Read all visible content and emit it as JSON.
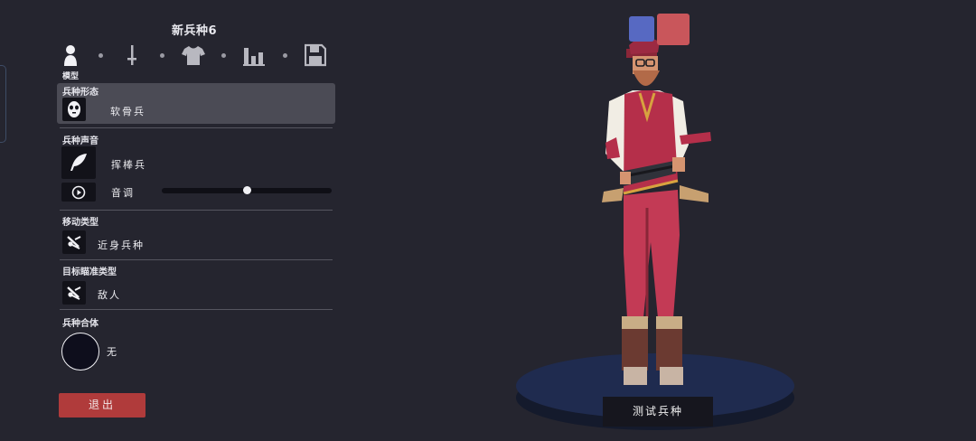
{
  "header": {
    "title": "新兵种6"
  },
  "tabs": {
    "active_label": "模型"
  },
  "sections": {
    "form": {
      "label": "兵种形态",
      "value": "软骨兵"
    },
    "voice": {
      "label": "兵种声音",
      "value": "挥棒兵",
      "pitch_label": "音调",
      "pitch_level": 0.5
    },
    "movement": {
      "label": "移动类型",
      "value": "近身兵种"
    },
    "targeting": {
      "label": "目标瞄准类型",
      "value": "敌人"
    },
    "merge": {
      "label": "兵种合体",
      "value": "无"
    }
  },
  "buttons": {
    "exit": "退出",
    "test": "测试兵种"
  },
  "team_colors": {
    "blue": "#5769c2",
    "red": "#c9565b"
  },
  "icons": [
    "person-icon",
    "sword-icon",
    "shirt-icon",
    "bar-chart-icon",
    "save-icon",
    "mask-icon",
    "feather-icon",
    "play-icon",
    "melee-icon",
    "target-icon"
  ],
  "colors": {
    "background": "#25252f",
    "selected_row": "#4b4b55",
    "exit_button": "#b03b3b"
  }
}
